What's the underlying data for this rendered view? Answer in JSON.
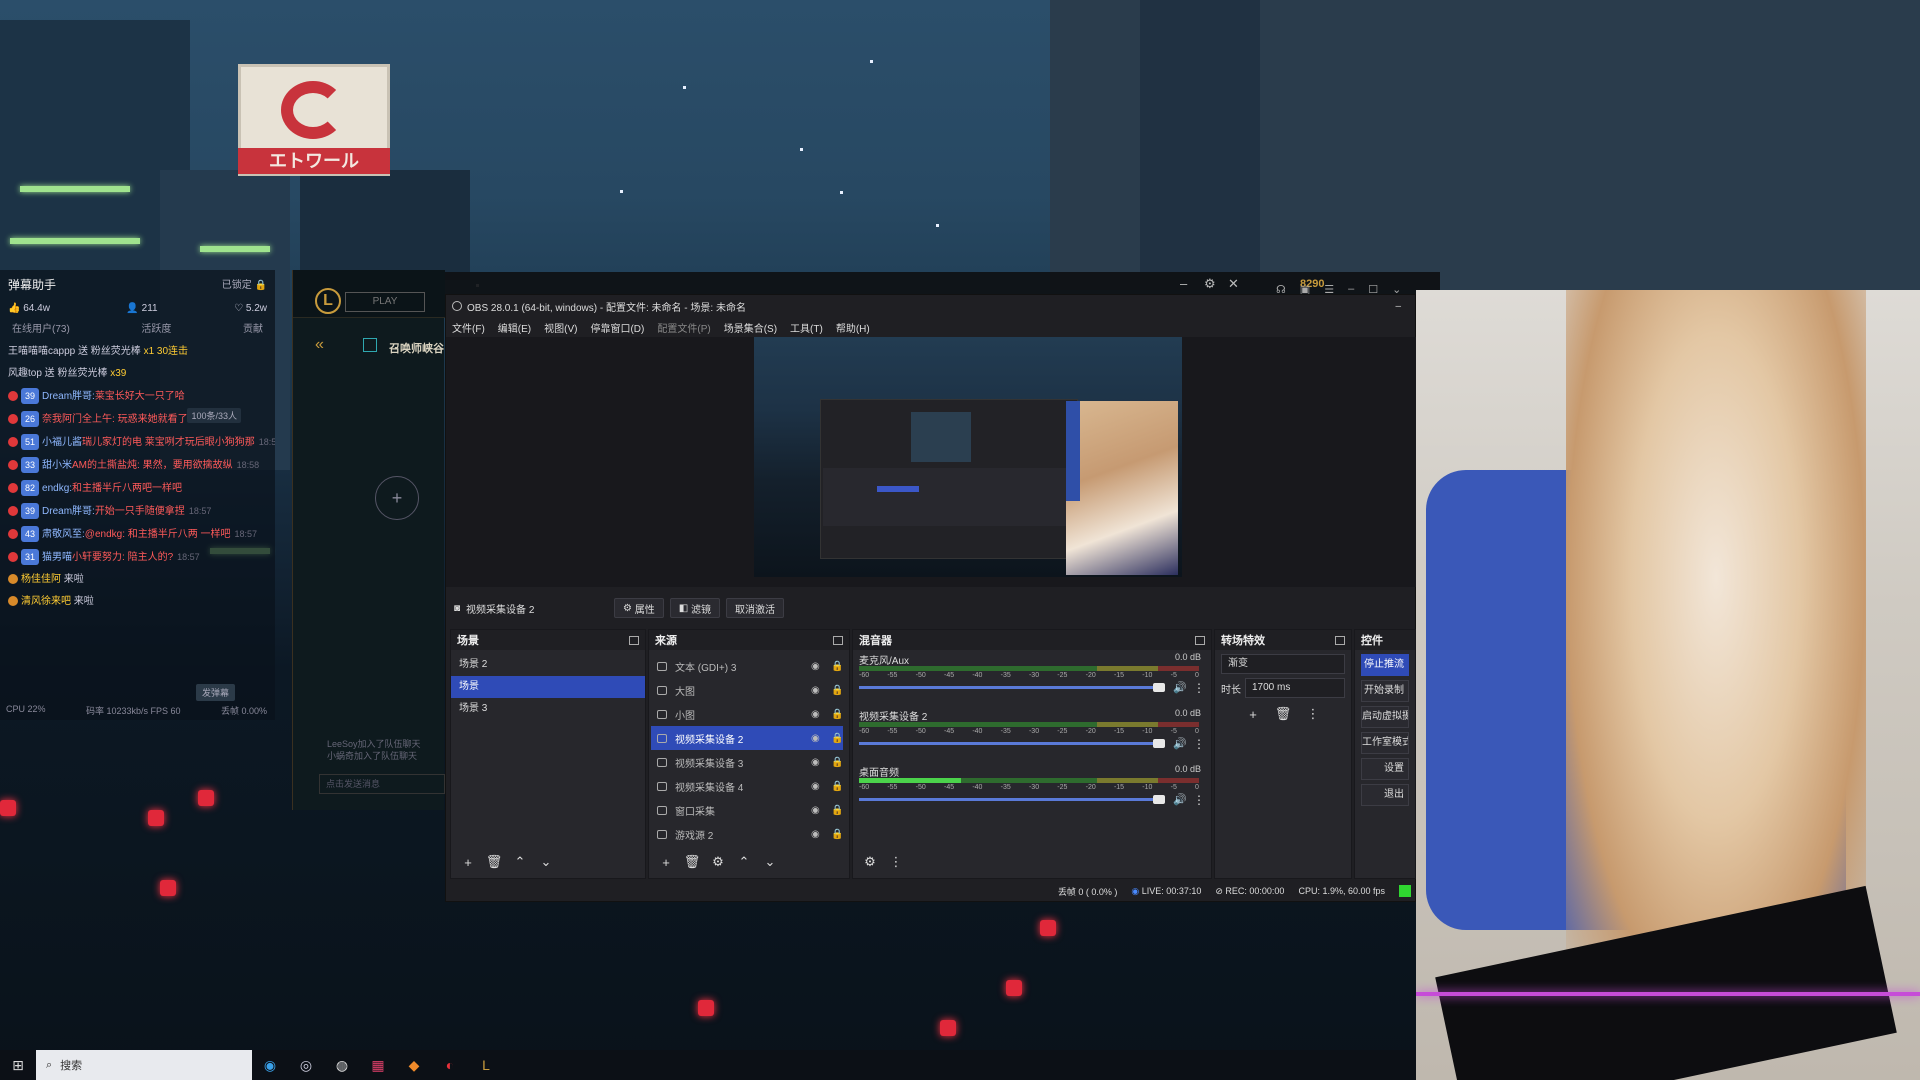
{
  "assistant": {
    "title": "弹幕助手",
    "locked": "已锁定",
    "stats": {
      "likes": "64.4w",
      "viewers": "211",
      "hearts": "5.2w"
    },
    "tabs": [
      "在线用户(73)",
      "活跃度",
      "贡献"
    ],
    "gift_lines": [
      {
        "text": "王喵喵喵cappp 送 粉丝荧光棒",
        "extra": "x1 30连击"
      },
      {
        "text": "风趣top 送 粉丝荧光棒",
        "extra": "x39"
      }
    ],
    "count_badge": "100条/33人",
    "messages": [
      {
        "level": "39",
        "nick": "Dream胖哥:",
        "text": "莱宝长好大一只了哈",
        "time": ""
      },
      {
        "level": "26",
        "nick": "",
        "text": "奈我阿门全上午: 玩惑来她就看了",
        "time": "18:58"
      },
      {
        "level": "51",
        "nick": "小福儿酱",
        "text": "瑞儿家灯的电 莱宝咧才玩后眼小狗狗那",
        "time": "18:58"
      },
      {
        "level": "33",
        "nick": "甜小米",
        "text": "AM的土撕盐炖: 果然，要用欲擒故纵",
        "time": "18:58"
      },
      {
        "level": "82",
        "nick": "endkg:",
        "text": "和主播半斤八两吧一样吧",
        "time": ""
      },
      {
        "level": "39",
        "nick": "Dream胖哥:",
        "text": "开始一只手随便拿捏",
        "time": "18:57"
      },
      {
        "level": "43",
        "nick": "肃敬风至:",
        "text": "@endkg: 和主播半斤八两 一样吧",
        "time": "18:57"
      },
      {
        "level": "31",
        "nick": "猫男喵",
        "text": "小轩要努力: 陪主人的?",
        "time": "18:57"
      }
    ],
    "entries": [
      {
        "name": "杨佳佳阿",
        "text": "来啦"
      },
      {
        "name": "清风徐来吧",
        "text": "来啦"
      }
    ],
    "button": "发弹幕",
    "footer": {
      "cpu": "CPU 22%",
      "bitrate": "码率 10233kb/s FPS 60",
      "drop": "丢帧 0.00%"
    }
  },
  "league": {
    "play_label": "PLAY",
    "title": "召唤师峡谷",
    "chat_hint_line1": "LeeSoy加入了队伍聊天",
    "chat_hint_line2": "小蜗奇加入了队伍聊天",
    "input_placeholder": "点击发送消息",
    "gold": "8290"
  },
  "obs": {
    "title": "OBS 28.0.1 (64-bit, windows) - 配置文件: 未命名 - 场景: 未命名",
    "menu": [
      "文件(F)",
      "编辑(E)",
      "视图(V)",
      "停靠窗口(D)",
      "配置文件(P)",
      "场景集合(S)",
      "工具(T)",
      "帮助(H)"
    ],
    "context": {
      "source": "视频采集设备 2",
      "properties": "属性",
      "filters": "滤镜",
      "deactivate": "取消激活"
    },
    "scenes": {
      "header": "场景",
      "items": [
        "场景 2",
        "场景",
        "场景 3"
      ],
      "selected": 1
    },
    "sources": {
      "header": "来源",
      "items": [
        "文本 (GDI+) 3",
        "大图",
        "小图",
        "视频采集设备 2",
        "视频采集设备 3",
        "视频采集设备 4",
        "窗口采集",
        "游戏源 2"
      ],
      "selected": 3
    },
    "mixer": {
      "header": "混音器",
      "ticks": [
        "-60",
        "-55",
        "-50",
        "-45",
        "-40",
        "-35",
        "-30",
        "-25",
        "-20",
        "-15",
        "-10",
        "-5",
        "0"
      ],
      "channels": [
        {
          "name": "麦克风/Aux",
          "db": "0.0 dB",
          "level": 0.0
        },
        {
          "name": "视频采集设备 2",
          "db": "0.0 dB",
          "level": 0.0
        },
        {
          "name": "桌面音频",
          "db": "0.0 dB",
          "level": 0.3
        }
      ]
    },
    "transitions": {
      "header": "转场特效",
      "type": "渐变",
      "duration_label": "时长",
      "duration": "1700 ms"
    },
    "controls": {
      "header": "控件",
      "buttons": [
        "停止推流",
        "开始录制",
        "启动虚拟摄像机",
        "工作室模式",
        "设置",
        "退出"
      ]
    },
    "status": {
      "dropped": "丢帧 0 ( 0.0% )",
      "live": "LIVE: 00:37:10",
      "rec": "REC: 00:00:00",
      "cpu": "CPU: 1.9%, 60.00 fps"
    }
  },
  "taskbar": {
    "search_placeholder": "搜索"
  },
  "colors": {
    "obs_accent": "#2f4bb7",
    "status_ok": "#2fd630"
  }
}
